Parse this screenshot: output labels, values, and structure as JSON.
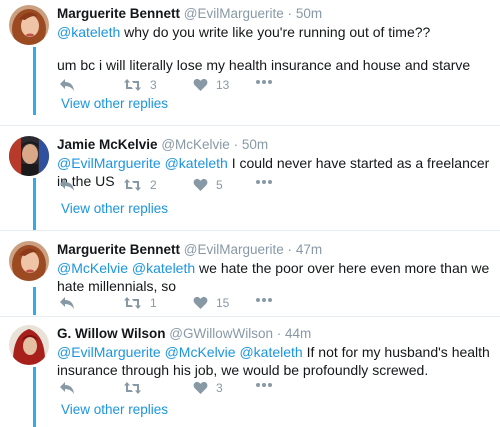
{
  "tweets": [
    {
      "name": "Marguerite Bennett",
      "handle": "@EvilMarguerite",
      "sep": "·",
      "time": "50m",
      "mentions": "@kateleth",
      "text": " why do you write like you're running out of time??",
      "text2": "um bc i will literally lose my health insurance and house and starve",
      "retweets": "3",
      "likes": "13",
      "view_replies": "View other replies"
    },
    {
      "name": "Jamie McKelvie",
      "handle": "@McKelvie",
      "sep": "·",
      "time": "50m",
      "mentions": "@EvilMarguerite @kateleth",
      "text": " I could never have started as a freelancer in the US",
      "retweets": "2",
      "likes": "5",
      "view_replies": "View other replies"
    },
    {
      "name": "Marguerite Bennett",
      "handle": "@EvilMarguerite",
      "sep": "·",
      "time": "47m",
      "mentions": "@McKelvie @kateleth",
      "text": " we hate the poor over here even more than we hate millennials, so",
      "retweets": "1",
      "likes": "15"
    },
    {
      "name": "G. Willow Wilson",
      "handle": "@GWillowWilson",
      "sep": "·",
      "time": "44m",
      "mentions": "@EvilMarguerite @McKelvie @kateleth",
      "text": " If not for my husband's health insurance through his job, we would be profoundly screwed.",
      "retweets": "",
      "likes": "3",
      "view_replies": "View other replies"
    }
  ],
  "icons": {
    "reply": "reply-icon",
    "retweet": "retweet-icon",
    "like": "heart-icon",
    "more": "more-icon"
  },
  "colors": {
    "link": "#1b95e0",
    "meta": "#8899a6",
    "thread": "#33aaee",
    "divider": "#e6ecf0"
  }
}
